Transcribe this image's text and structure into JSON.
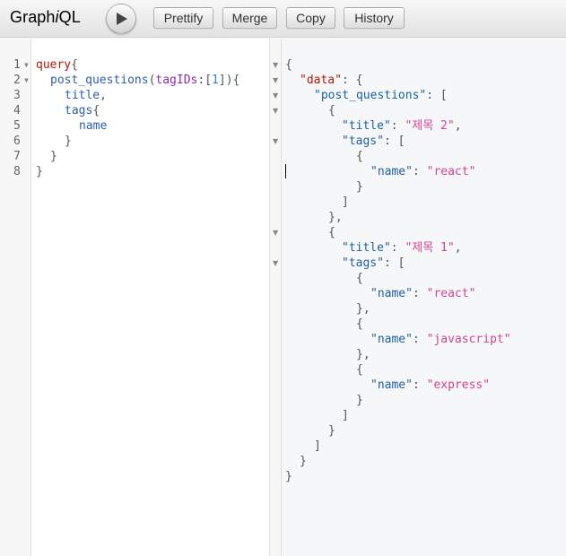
{
  "header": {
    "logo_prefix": "Graph",
    "logo_i": "i",
    "logo_suffix": "QL",
    "buttons": {
      "prettify": "Prettify",
      "merge": "Merge",
      "copy": "Copy",
      "history": "History"
    }
  },
  "query_editor": {
    "line_numbers": [
      "1",
      "2",
      "3",
      "4",
      "5",
      "6",
      "7",
      "8"
    ],
    "tokens": {
      "query_kw": "query",
      "open_brace": "{",
      "close_brace": "}",
      "field_post_questions": "post_questions",
      "open_paren": "(",
      "close_paren": ")",
      "arg_name": "tagIDs",
      "colon": ":",
      "open_bracket": "[",
      "close_bracket": "]",
      "arg_value": "1",
      "field_title": "title",
      "comma": ",",
      "field_tags": "tags",
      "field_name": "name"
    }
  },
  "result": {
    "json_tokens": {
      "open_brace": "{",
      "close_brace": "}",
      "open_bracket": "[",
      "close_bracket": "]",
      "colon": ": ",
      "comma": ",",
      "key_data": "\"data\"",
      "key_post_questions": "\"post_questions\"",
      "key_title": "\"title\"",
      "key_tags": "\"tags\"",
      "key_name": "\"name\"",
      "title_1": "\"제목 2\"",
      "title_2": "\"제목 1\"",
      "tag_react": "\"react\"",
      "tag_javascript": "\"javascript\"",
      "tag_express": "\"express\""
    }
  },
  "colors": {
    "keyword": "#b11a04",
    "field": "#2a5fb5",
    "argument": "#8b2bb9",
    "number": "#2882f9",
    "json_key": "#1f61a0",
    "json_string": "#d64292"
  }
}
